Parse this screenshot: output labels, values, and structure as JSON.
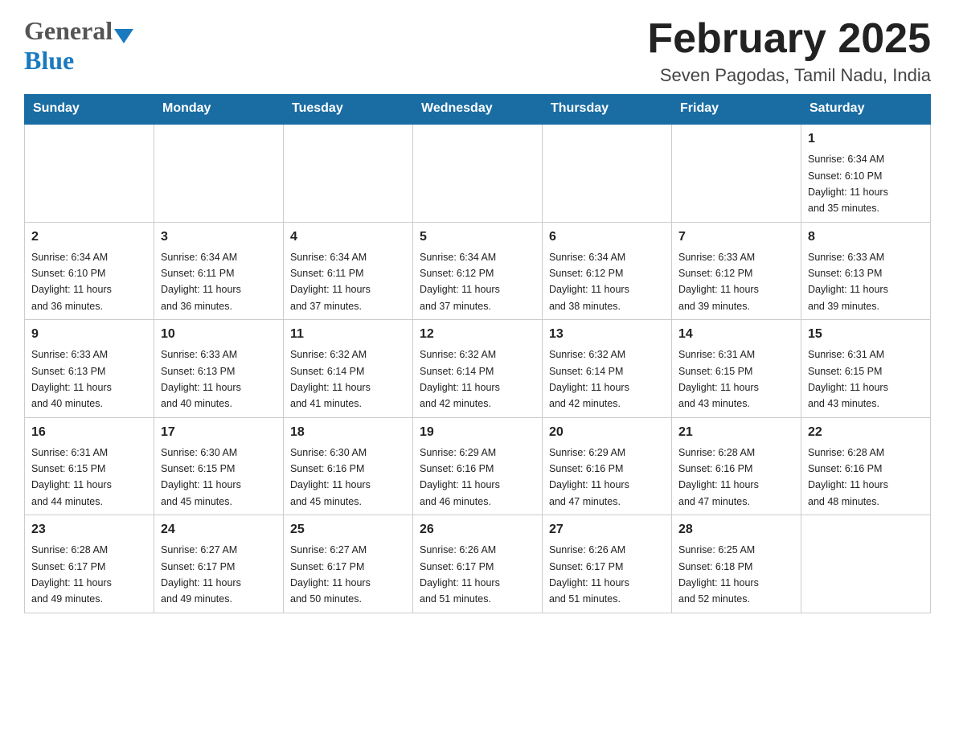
{
  "logo": {
    "text_general": "General",
    "triangle": "▼",
    "text_blue": "Blue"
  },
  "title": "February 2025",
  "subtitle": "Seven Pagodas, Tamil Nadu, India",
  "days_header": [
    "Sunday",
    "Monday",
    "Tuesday",
    "Wednesday",
    "Thursday",
    "Friday",
    "Saturday"
  ],
  "weeks": [
    [
      {
        "day": "",
        "info": ""
      },
      {
        "day": "",
        "info": ""
      },
      {
        "day": "",
        "info": ""
      },
      {
        "day": "",
        "info": ""
      },
      {
        "day": "",
        "info": ""
      },
      {
        "day": "",
        "info": ""
      },
      {
        "day": "1",
        "info": "Sunrise: 6:34 AM\nSunset: 6:10 PM\nDaylight: 11 hours\nand 35 minutes."
      }
    ],
    [
      {
        "day": "2",
        "info": "Sunrise: 6:34 AM\nSunset: 6:10 PM\nDaylight: 11 hours\nand 36 minutes."
      },
      {
        "day": "3",
        "info": "Sunrise: 6:34 AM\nSunset: 6:11 PM\nDaylight: 11 hours\nand 36 minutes."
      },
      {
        "day": "4",
        "info": "Sunrise: 6:34 AM\nSunset: 6:11 PM\nDaylight: 11 hours\nand 37 minutes."
      },
      {
        "day": "5",
        "info": "Sunrise: 6:34 AM\nSunset: 6:12 PM\nDaylight: 11 hours\nand 37 minutes."
      },
      {
        "day": "6",
        "info": "Sunrise: 6:34 AM\nSunset: 6:12 PM\nDaylight: 11 hours\nand 38 minutes."
      },
      {
        "day": "7",
        "info": "Sunrise: 6:33 AM\nSunset: 6:12 PM\nDaylight: 11 hours\nand 39 minutes."
      },
      {
        "day": "8",
        "info": "Sunrise: 6:33 AM\nSunset: 6:13 PM\nDaylight: 11 hours\nand 39 minutes."
      }
    ],
    [
      {
        "day": "9",
        "info": "Sunrise: 6:33 AM\nSunset: 6:13 PM\nDaylight: 11 hours\nand 40 minutes."
      },
      {
        "day": "10",
        "info": "Sunrise: 6:33 AM\nSunset: 6:13 PM\nDaylight: 11 hours\nand 40 minutes."
      },
      {
        "day": "11",
        "info": "Sunrise: 6:32 AM\nSunset: 6:14 PM\nDaylight: 11 hours\nand 41 minutes."
      },
      {
        "day": "12",
        "info": "Sunrise: 6:32 AM\nSunset: 6:14 PM\nDaylight: 11 hours\nand 42 minutes."
      },
      {
        "day": "13",
        "info": "Sunrise: 6:32 AM\nSunset: 6:14 PM\nDaylight: 11 hours\nand 42 minutes."
      },
      {
        "day": "14",
        "info": "Sunrise: 6:31 AM\nSunset: 6:15 PM\nDaylight: 11 hours\nand 43 minutes."
      },
      {
        "day": "15",
        "info": "Sunrise: 6:31 AM\nSunset: 6:15 PM\nDaylight: 11 hours\nand 43 minutes."
      }
    ],
    [
      {
        "day": "16",
        "info": "Sunrise: 6:31 AM\nSunset: 6:15 PM\nDaylight: 11 hours\nand 44 minutes."
      },
      {
        "day": "17",
        "info": "Sunrise: 6:30 AM\nSunset: 6:15 PM\nDaylight: 11 hours\nand 45 minutes."
      },
      {
        "day": "18",
        "info": "Sunrise: 6:30 AM\nSunset: 6:16 PM\nDaylight: 11 hours\nand 45 minutes."
      },
      {
        "day": "19",
        "info": "Sunrise: 6:29 AM\nSunset: 6:16 PM\nDaylight: 11 hours\nand 46 minutes."
      },
      {
        "day": "20",
        "info": "Sunrise: 6:29 AM\nSunset: 6:16 PM\nDaylight: 11 hours\nand 47 minutes."
      },
      {
        "day": "21",
        "info": "Sunrise: 6:28 AM\nSunset: 6:16 PM\nDaylight: 11 hours\nand 47 minutes."
      },
      {
        "day": "22",
        "info": "Sunrise: 6:28 AM\nSunset: 6:16 PM\nDaylight: 11 hours\nand 48 minutes."
      }
    ],
    [
      {
        "day": "23",
        "info": "Sunrise: 6:28 AM\nSunset: 6:17 PM\nDaylight: 11 hours\nand 49 minutes."
      },
      {
        "day": "24",
        "info": "Sunrise: 6:27 AM\nSunset: 6:17 PM\nDaylight: 11 hours\nand 49 minutes."
      },
      {
        "day": "25",
        "info": "Sunrise: 6:27 AM\nSunset: 6:17 PM\nDaylight: 11 hours\nand 50 minutes."
      },
      {
        "day": "26",
        "info": "Sunrise: 6:26 AM\nSunset: 6:17 PM\nDaylight: 11 hours\nand 51 minutes."
      },
      {
        "day": "27",
        "info": "Sunrise: 6:26 AM\nSunset: 6:17 PM\nDaylight: 11 hours\nand 51 minutes."
      },
      {
        "day": "28",
        "info": "Sunrise: 6:25 AM\nSunset: 6:18 PM\nDaylight: 11 hours\nand 52 minutes."
      },
      {
        "day": "",
        "info": ""
      }
    ]
  ],
  "colors": {
    "header_bg": "#1a6da3",
    "header_text": "#ffffff",
    "border": "#cccccc",
    "accent_blue": "#1a7abf"
  }
}
